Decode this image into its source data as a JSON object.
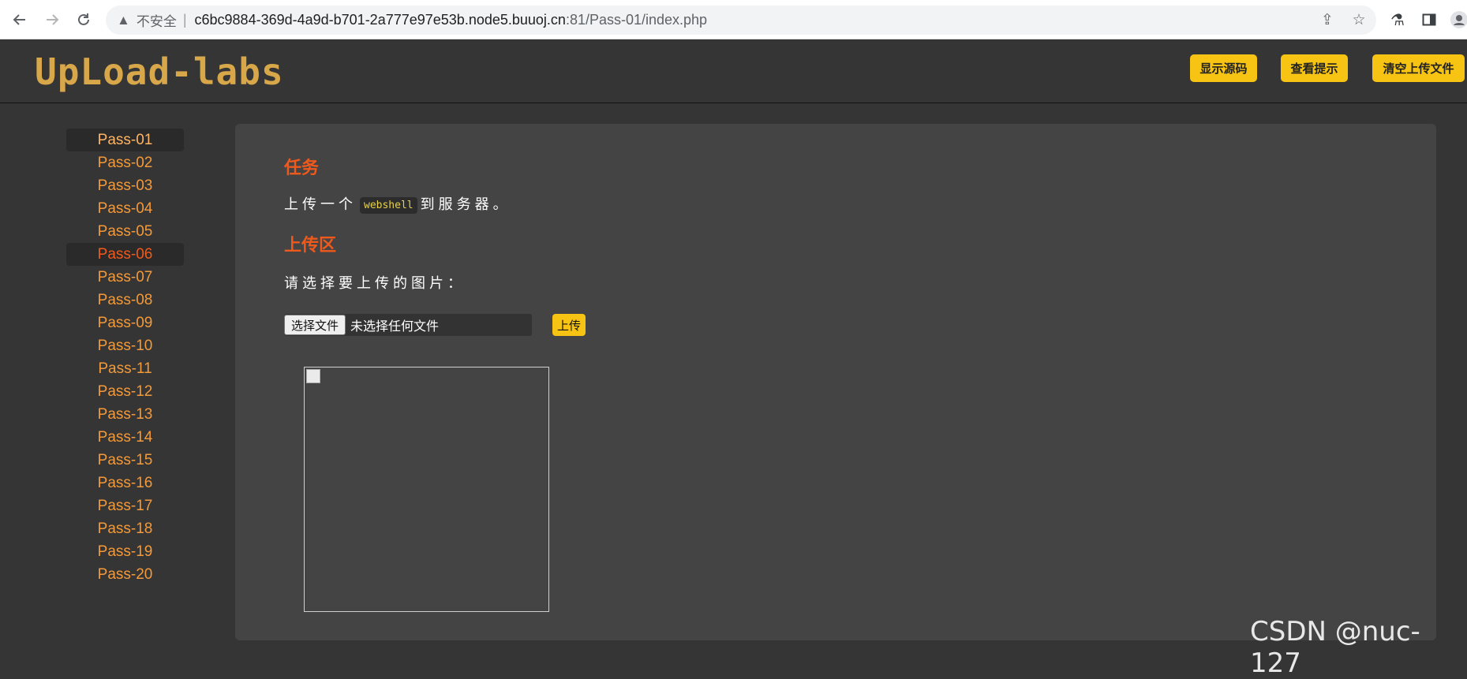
{
  "browser": {
    "back_icon": "arrow-left-icon",
    "forward_icon": "arrow-right-icon",
    "reload_icon": "reload-icon",
    "security_label": "不安全",
    "separator": "|",
    "url_host": "c6bc9884-369d-4a9d-b701-2a777e97e53b.node5.buuoj.cn",
    "url_path": ":81/Pass-01/index.php"
  },
  "header": {
    "logo": "UpLoad-labs",
    "buttons": {
      "show_source": "显示源码",
      "view_hint": "查看提示",
      "clear_uploads": "清空上传文件"
    },
    "button_color": "#f7c413"
  },
  "sidebar": {
    "items": [
      {
        "label": "Pass-01"
      },
      {
        "label": "Pass-02"
      },
      {
        "label": "Pass-03"
      },
      {
        "label": "Pass-04"
      },
      {
        "label": "Pass-05"
      },
      {
        "label": "Pass-06"
      },
      {
        "label": "Pass-07"
      },
      {
        "label": "Pass-08"
      },
      {
        "label": "Pass-09"
      },
      {
        "label": "Pass-10"
      },
      {
        "label": "Pass-11"
      },
      {
        "label": "Pass-12"
      },
      {
        "label": "Pass-13"
      },
      {
        "label": "Pass-14"
      },
      {
        "label": "Pass-15"
      },
      {
        "label": "Pass-16"
      },
      {
        "label": "Pass-17"
      },
      {
        "label": "Pass-18"
      },
      {
        "label": "Pass-19"
      },
      {
        "label": "Pass-20"
      }
    ],
    "item_color": "#f39a3a",
    "active_color": "#f05a1a"
  },
  "main": {
    "task_title": "任务",
    "task_prefix": "上传一个",
    "task_code": "webshell",
    "task_suffix": "到服务器。",
    "upload_title": "上传区",
    "upload_prompt": "请选择要上传的图片：",
    "file_button": "选择文件",
    "file_status": "未选择任何文件",
    "upload_button": "上传",
    "title_color": "#f0591c"
  },
  "watermark": "CSDN @nuc-127"
}
